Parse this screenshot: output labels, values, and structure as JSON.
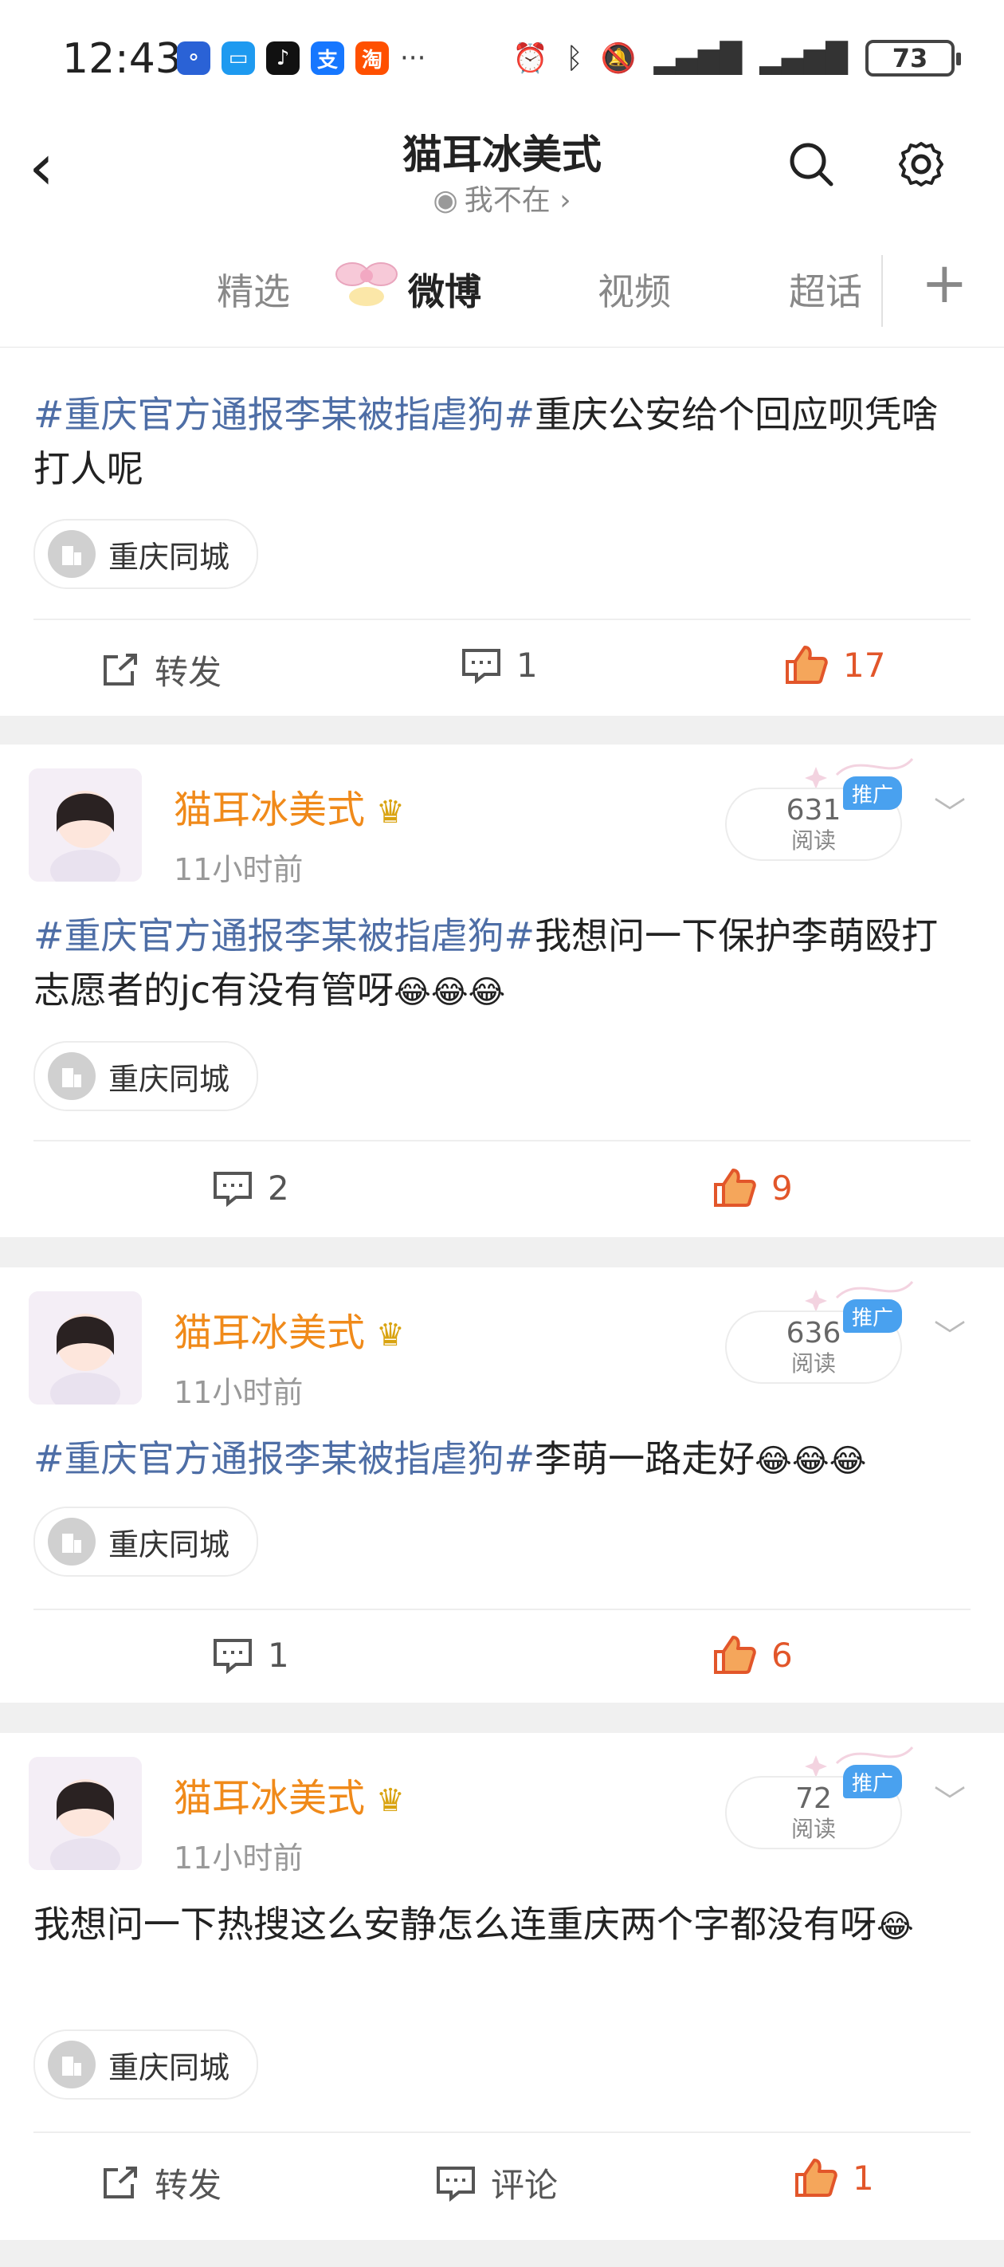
{
  "status_bar": {
    "time": "12:43",
    "battery": "73",
    "app_icons": [
      {
        "name": "bank-app-icon",
        "glyph": "⚬",
        "color": "#2a62d6"
      },
      {
        "name": "message-app-icon",
        "glyph": "💬",
        "color": "#1e9af0"
      },
      {
        "name": "tiktok-app-icon",
        "glyph": "♪",
        "color": "#111111"
      },
      {
        "name": "alipay-app-icon",
        "glyph": "支",
        "color": "#1677ff"
      },
      {
        "name": "taobao-app-icon",
        "glyph": "淘",
        "color": "#ff5000"
      }
    ],
    "more": "···"
  },
  "header": {
    "title": "猫耳冰美式",
    "subtitle": "我不在",
    "subtitle_arrow": "›"
  },
  "tabs": [
    {
      "label": "精选",
      "active": false
    },
    {
      "label": "微博",
      "active": true
    },
    {
      "label": "视频",
      "active": false
    },
    {
      "label": "超话",
      "active": false
    }
  ],
  "tab_add": "+",
  "posts": [
    {
      "partial": true,
      "hashtag": "#重庆官方通报李某被指虐狗#",
      "text": "重庆公安给个回应呗凭啥打人呢",
      "location": "重庆同城",
      "actions": {
        "repost": "转发",
        "comment": "1",
        "like": "17"
      }
    },
    {
      "author": "猫耳冰美式",
      "time": "11小时前",
      "views": "631",
      "views_label": "阅读",
      "promo": "推广",
      "hashtag": "#重庆官方通报李某被指虐狗#",
      "text": "我想问一下保护李萌殴打志愿者的jc有没有管呀",
      "emoji": "😂😂😂",
      "location": "重庆同城",
      "actions": {
        "comment": "2",
        "like": "9"
      }
    },
    {
      "author": "猫耳冰美式",
      "time": "11小时前",
      "views": "636",
      "views_label": "阅读",
      "promo": "推广",
      "hashtag": "#重庆官方通报李某被指虐狗#",
      "text": "李萌一路走好",
      "emoji": "😂😂😂",
      "location": "重庆同城",
      "actions": {
        "comment": "1",
        "like": "6"
      }
    },
    {
      "author": "猫耳冰美式",
      "time": "11小时前",
      "views": "72",
      "views_label": "阅读",
      "promo": "推广",
      "text": "我想问一下热搜这么安静怎么连重庆两个字都没有呀",
      "emoji": "😂",
      "location": "重庆同城",
      "actions": {
        "repost": "转发",
        "comment": "评论",
        "like": "1"
      }
    }
  ],
  "colors": {
    "accent_like": "#e2562a",
    "author": "#f08a1a",
    "hashtag": "#4e6ea6",
    "promo": "#49a1ef"
  }
}
